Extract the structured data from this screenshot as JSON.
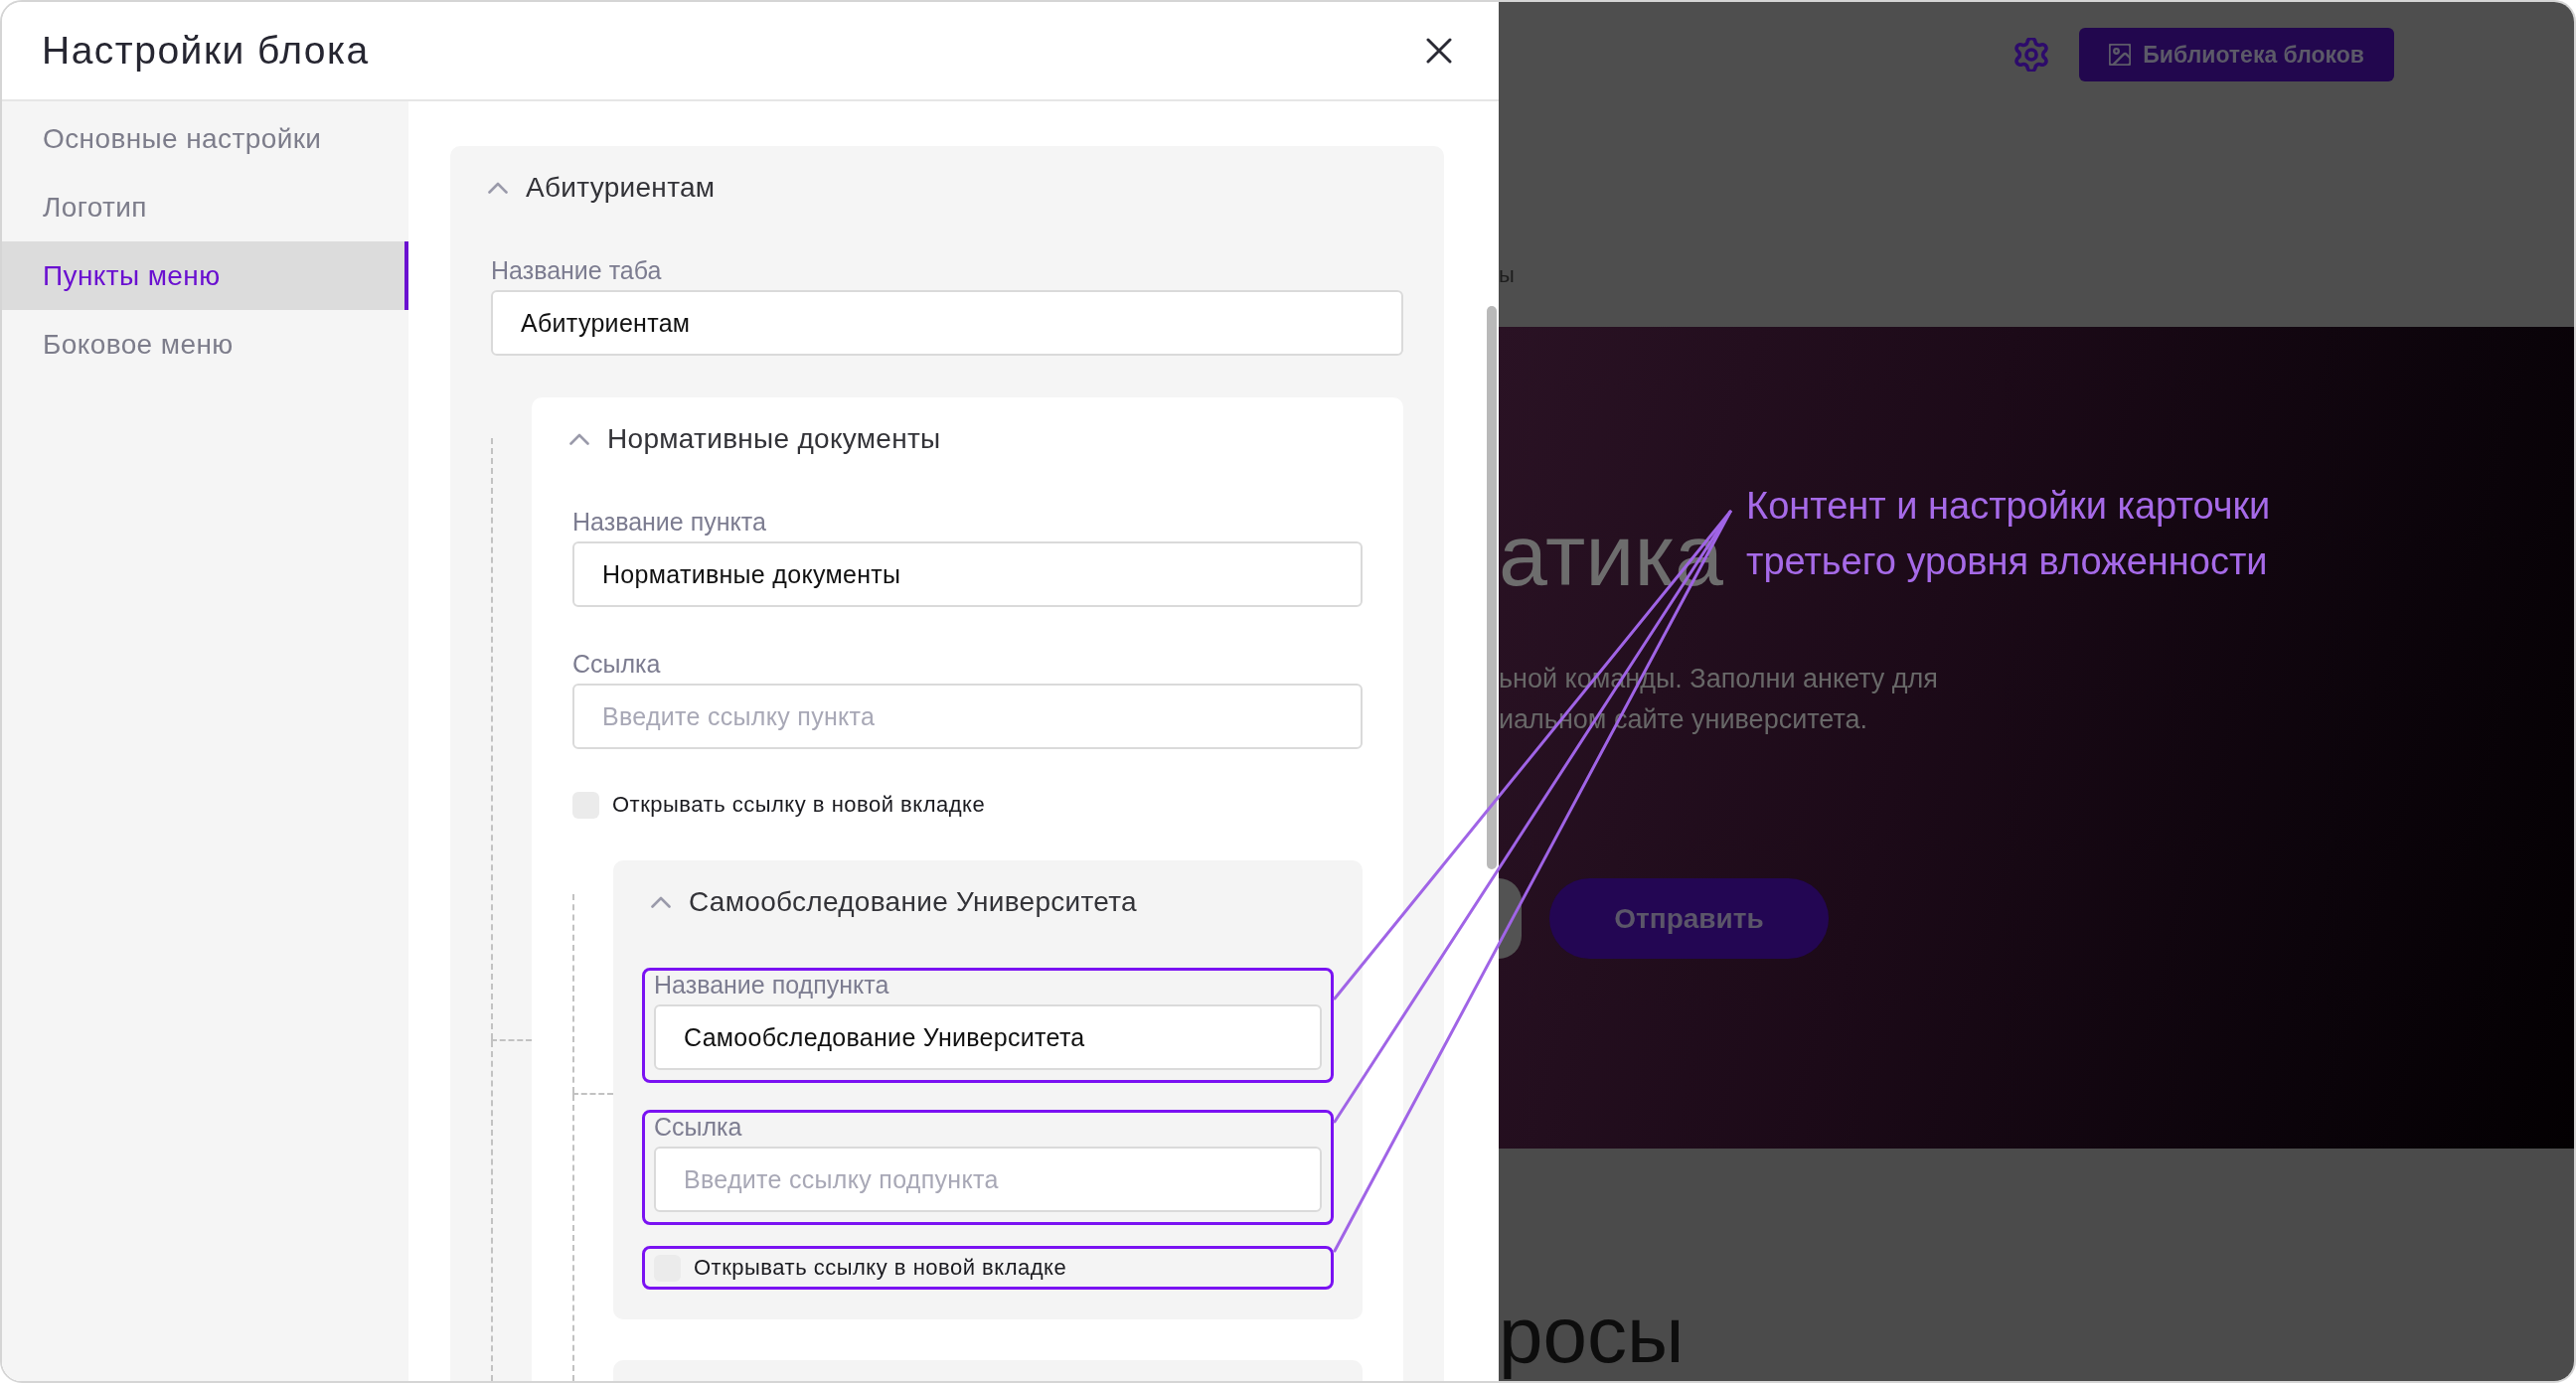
{
  "modal": {
    "title": "Настройки блока"
  },
  "sidebar": {
    "items": [
      {
        "label": "Основные настройки",
        "selected": false
      },
      {
        "label": "Логотип",
        "selected": false
      },
      {
        "label": "Пункты меню",
        "selected": true
      },
      {
        "label": "Боковое меню",
        "selected": false
      }
    ]
  },
  "menu_tabs": [
    {
      "kind": "card",
      "title": "Абитуриентам",
      "expanded": true,
      "fields": [
        {
          "label": "Название таба",
          "value": "Абитуриентам",
          "highlighted": false
        }
      ],
      "children": [
        {
          "kind": "card",
          "title": "Нормативные документы",
          "expanded": true,
          "fields": [
            {
              "label": "Название пункта",
              "value": "Нормативные документы",
              "highlighted": false
            },
            {
              "label": "Ссылка",
              "placeholder": "Введите ссылку пункта",
              "highlighted": false
            }
          ],
          "new_tab": {
            "label": "Открывать ссылку в новой вкладке",
            "checked": false,
            "highlighted": false
          },
          "children": [
            {
              "kind": "card",
              "title": "Самообследование Университета",
              "expanded": true,
              "fields": [
                {
                  "label": "Название подпункта",
                  "value": "Самообследование Университета",
                  "highlighted": true
                },
                {
                  "label": "Ссылка",
                  "placeholder": "Введите ссылку подпункта",
                  "highlighted": true
                }
              ],
              "new_tab": {
                "label": "Открывать ссылку в новой вкладке",
                "checked": false,
                "highlighted": true
              }
            },
            {
              "kind": "stub"
            }
          ]
        }
      ]
    }
  ],
  "annotation": {
    "text": "Контент и настройки карточки третьего уровня вложенности"
  },
  "background_page": {
    "library_button": "Библиотека блоков",
    "nav_fragment": "ы",
    "hero": {
      "title": "атика",
      "text_lines": [
        "ьной команды. Заполни анкету для",
        "иальном сайте университета."
      ],
      "submit_button": "Отправить"
    },
    "section_title": "росы"
  }
}
